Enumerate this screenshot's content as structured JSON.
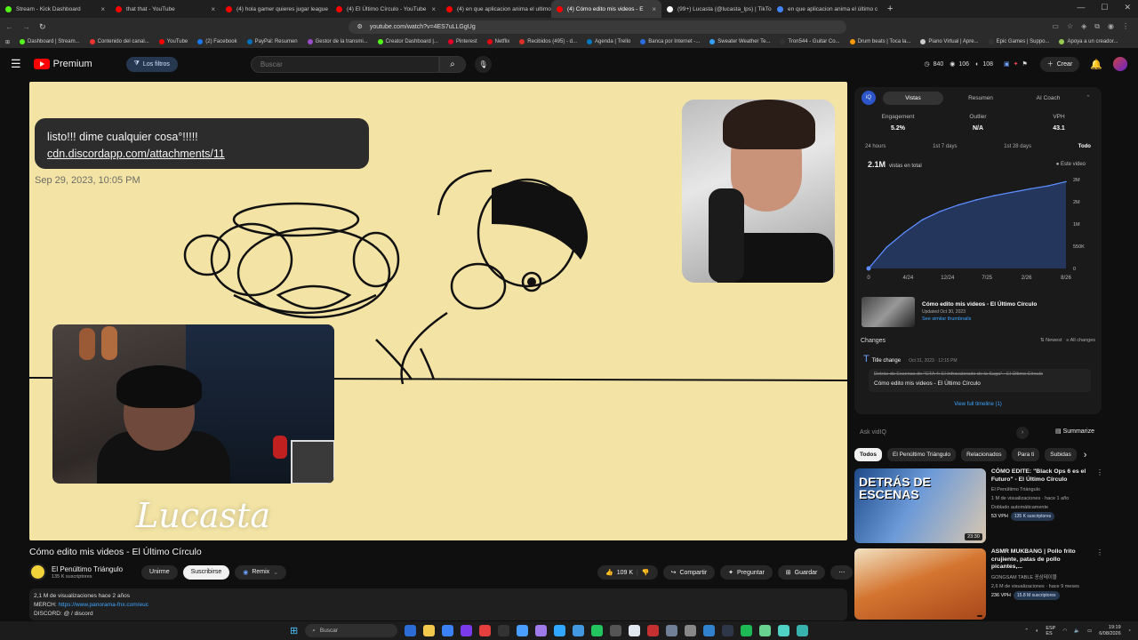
{
  "browser": {
    "tabs": [
      {
        "title": "Stream - Kick Dashboard",
        "color": "#53fc18"
      },
      {
        "title": "that that - YouTube",
        "color": "#ff0000"
      },
      {
        "title": "(4) hola gamer quieres jugar league",
        "color": "#ff0000"
      },
      {
        "title": "(4) El Último Círculo - YouTube",
        "color": "#ff0000"
      },
      {
        "title": "(4) en que aplicacion anima el ultimo",
        "color": "#ff0000"
      },
      {
        "title": "(4) Cómo edito mis videos - E",
        "color": "#ff0000",
        "active": true
      },
      {
        "title": "(99+) Lucasta (@lucasta_lps) | TikTok",
        "color": "#ffffff"
      },
      {
        "title": "en que aplicacion anima el último c",
        "color": "#4285f4"
      }
    ],
    "url": "youtube.com/watch?v=4ES7uLLGgUg",
    "bookmarks": [
      "Dashboard | Stream...",
      "Contenido del canal...",
      "YouTube",
      "(2) Facebook",
      "PayPal: Resumen",
      "Gestor de la transmi...",
      "Creator Dashboard |...",
      "Pinterest",
      "Netflix",
      "Recibidos (495) - d...",
      "Agenda | Trello",
      "Banca por Internet -...",
      "Sweater Weather Te...",
      "Tron544 - Guitar Co...",
      "Drum beats | Toca la...",
      "Piano Virtual | Apre...",
      "Epic Games | Suppo...",
      "Apoya a un creador..."
    ]
  },
  "header": {
    "logo": "Premium",
    "filters": "Los filtros",
    "search_placeholder": "Buscar",
    "stats": [
      "840",
      "106",
      "108"
    ],
    "create": "Crear",
    "notif_count": "9+"
  },
  "video": {
    "bubble_text": "listo!!! dime cualquier cosa°!!!!!",
    "bubble_link": "cdn.discordapp.com/attachments/11",
    "date": "Sep 29, 2023, 10:05 PM",
    "watermark": "Lucasta",
    "title": "Cómo edito mis videos - El Último Círculo",
    "channel": "El Penúltimo Triángulo",
    "subs": "135 K suscriptores",
    "join": "Unirme",
    "subscribe": "Suscribirse",
    "remix": "Remix",
    "likes": "109 K",
    "share": "Compartir",
    "ask": "Preguntar",
    "save": "Guardar",
    "desc_views": "2,1 M de visualizaciones  hace 2 años",
    "desc_merch_label": "MERCH:",
    "desc_merch_link": "https://www.panorama-fnx.com/euc",
    "desc_discord": "DISCORD: @ / discord"
  },
  "vidiq": {
    "tabs": [
      "Vistas",
      "Resumen",
      "AI Coach"
    ],
    "metrics": [
      {
        "label": "Engagement",
        "value": "5.2%"
      },
      {
        "label": "Outlier",
        "value": "N/A"
      },
      {
        "label": "VPH",
        "value": "43.1"
      }
    ],
    "ranges": [
      "24 hours",
      "1st 7 days",
      "1st 28 days",
      "Todo"
    ],
    "total_views": "2.1M",
    "total_label": "vistas en total",
    "este_video": "● Este video",
    "thumb_title": "Cómo edito mis videos - El Último Círculo",
    "thumb_updated": "Updated Oct 30, 2023",
    "thumb_link": "See similar thumbnails",
    "changes_label": "Changes",
    "newest": "Newest",
    "all_changes": "All changes",
    "change_type": "Title change",
    "change_date": "Oct 31, 2023 · 12:15 PM",
    "change_old": "Detrás de Escenas de \"GTA 4: El Infravalorado de la Saga\" - El Último Círculo",
    "change_new": "Cómo edito mis videos - El Último Círculo",
    "timeline_link": "View full timeline (1)",
    "ask_placeholder": "Ask vidIQ",
    "summarize": "Summarize"
  },
  "chart_data": {
    "type": "line",
    "x": [
      "0",
      "4/24",
      "12/24",
      "7/25",
      "2/26",
      "8/26"
    ],
    "y_ticks": [
      "0",
      "550K",
      "1M",
      "2M",
      "2M"
    ],
    "series": [
      {
        "values": [
          0,
          0.5,
          0.85,
          1.15,
          1.35,
          1.5,
          1.62,
          1.72,
          1.8,
          1.88,
          1.95,
          2.05
        ]
      }
    ],
    "ylim": [
      0,
      2.1
    ],
    "grid": false
  },
  "chips": [
    "Todos",
    "El Penúltimo Triángulo",
    "Relacionados",
    "Para ti",
    "Subidas"
  ],
  "recommendations": [
    {
      "title": "CÓMO EDITE: \"Black Ops 6 es el Futuro\" - El Último Círculo",
      "channel": "El Penúltimo Triángulo",
      "meta": "1 M de visualizaciones · hace 1 año",
      "dub": "Doblado automáticamente",
      "vph": "53 VPH",
      "badge": "135 K suscriptores",
      "duration": "23:30",
      "thumb_text": "DETRÁS DE ESCENAS"
    },
    {
      "title": "ASMR MUKBANG | Pollo frito crujiente, patas de pollo picantes,...",
      "channel": "GONGSAM TABLE 꽁삼테이블",
      "meta": "2,6 M de visualizaciones · hace 9 meses",
      "dub": "",
      "vph": "236 VPH",
      "badge": "15.8 M suscriptores",
      "duration": "",
      "thumb_text": ""
    }
  ],
  "taskbar": {
    "search": "Buscar",
    "lang": "ESP\nES",
    "time": "19:19",
    "date": "6/08/2026"
  }
}
